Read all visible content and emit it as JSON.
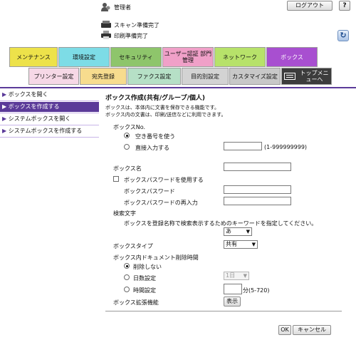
{
  "header": {
    "user_name": "管理者",
    "logout_label": "ログアウト",
    "help_label": "?",
    "scan_status": "スキャン準備完了",
    "print_status": "印刷準備完了"
  },
  "main_tabs": [
    "メンテナンス",
    "環境設定",
    "セキュリティ",
    "ユーザー認証 部門管理",
    "ネットワーク",
    "ボックス"
  ],
  "sub_tabs": [
    "プリンター設定",
    "宛先登録",
    "ファクス設定",
    "目的別設定",
    "カスタマイズ設定",
    "トップメニューへ"
  ],
  "sidebar": {
    "items": [
      "ボックスを開く",
      "ボックスを作成する",
      "システムボックスを開く",
      "システムボックスを作成する"
    ]
  },
  "form": {
    "title": "ボックス作成(共有/グループ/個人)",
    "desc1": "ボックスは、本体内に文書を保存できる機能です。",
    "desc2": "ボックス内の文書は、印刷/送信などに利用できます。",
    "box_no_label": "ボックスNo.",
    "opt_auto": "空き番号を使う",
    "opt_direct": "直接入力する",
    "box_no_value": "",
    "box_no_range": "(1-999999999)",
    "box_name_label": "ボックス名",
    "box_name_value": "",
    "use_password_label": "ボックスパスワードを使用する",
    "password_label": "ボックスパスワード",
    "password_confirm_label": "ボックスパスワードの再入力",
    "search_label": "検索文字",
    "search_desc": "ボックスを登録名称で検索表示するためのキーワードを指定してください。",
    "search_value": "あ",
    "box_type_label": "ボックスタイプ",
    "box_type_value": "共有",
    "delete_time_label": "ボックス内ドキュメント削除時間",
    "opt_no_delete": "削除しない",
    "opt_days": "日数設定",
    "days_value": "1日",
    "opt_time": "時間設定",
    "time_value": "",
    "time_range": "分(5-720)",
    "ext_label": "ボックス拡張機能",
    "show_button": "表示",
    "ok_button": "OK",
    "cancel_button": "キャンセル"
  },
  "colors": {
    "accent": "#5b3a99",
    "tab_maint": "#ede24a",
    "tab_env": "#7ddce6",
    "tab_sec": "#8ec56b",
    "tab_user": "#f0a0c8",
    "tab_net": "#b7e26a",
    "tab_box": "#a84fd0"
  }
}
